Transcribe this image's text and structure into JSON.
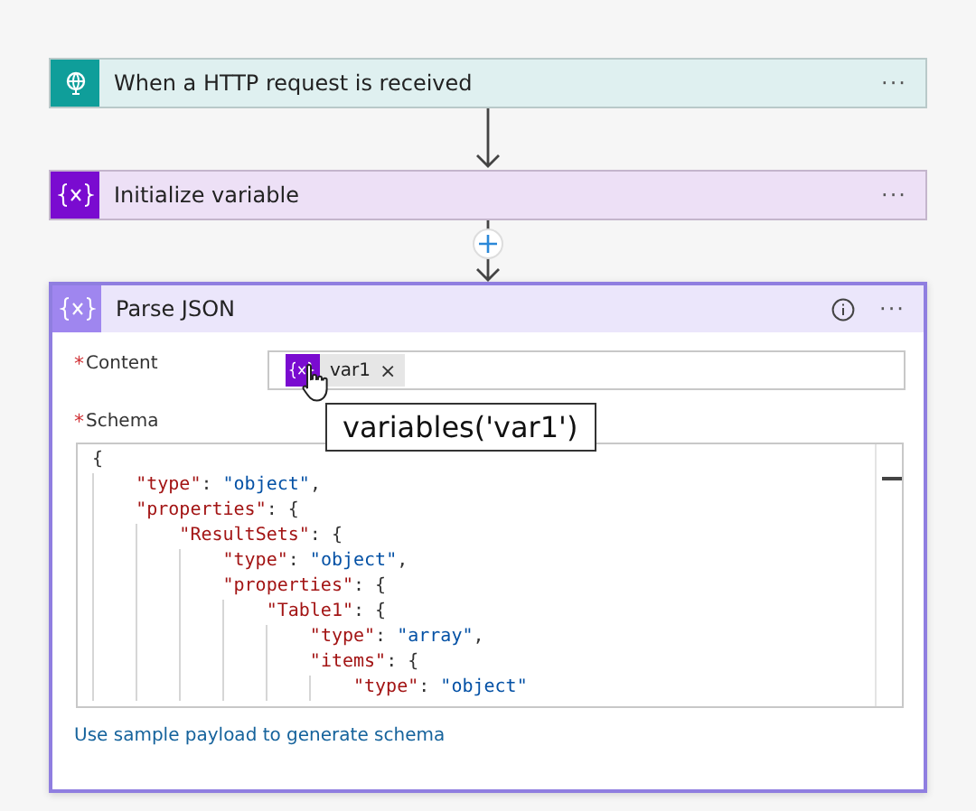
{
  "steps": [
    {
      "kind": "trigger",
      "title": "When a HTTP request is received",
      "more": "···"
    },
    {
      "kind": "variable",
      "title": "Initialize variable",
      "more": "···"
    },
    {
      "kind": "parse",
      "title": "Parse JSON",
      "more": "···",
      "content": {
        "label": "Content",
        "required_mark": "*",
        "token": {
          "label": "var1",
          "remove": "×"
        },
        "tooltip": "variables('var1')"
      },
      "schema": {
        "label": "Schema",
        "required_mark": "*",
        "lines": [
          {
            "text": "{",
            "children": [
              {
                "text": "\"type\": \"object\","
              },
              {
                "text": "\"properties\": {",
                "children": [
                  {
                    "text": "\"ResultSets\": {",
                    "children": [
                      {
                        "text": "\"type\": \"object\","
                      },
                      {
                        "text": "\"properties\": {",
                        "children": [
                          {
                            "text": "\"Table1\": {",
                            "children": [
                              {
                                "text": "\"type\": \"array\","
                              },
                              {
                                "text": "\"items\": {",
                                "children": [
                                  {
                                    "text": "\"type\": \"object\""
                                  }
                                ]
                              }
                            ]
                          }
                        ]
                      }
                    ]
                  }
                ]
              }
            ]
          }
        ]
      },
      "link": "Use sample payload to generate schema"
    }
  ]
}
